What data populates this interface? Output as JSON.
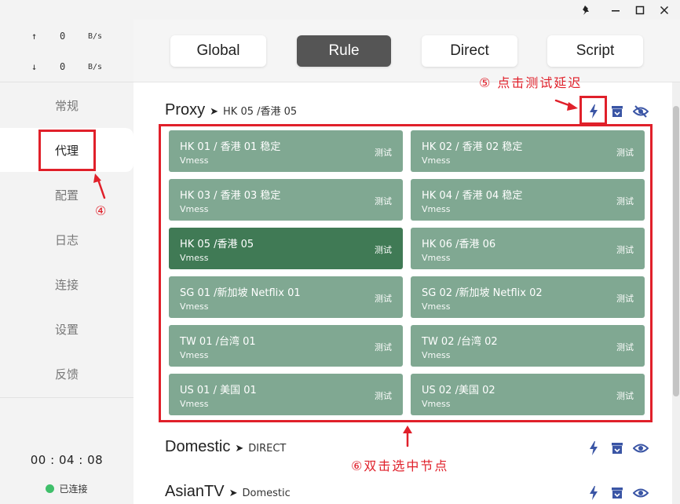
{
  "window": {
    "pin_icon": "pin-icon",
    "minimize_icon": "minimize-icon",
    "maximize_icon": "maximize-icon",
    "close_icon": "close-icon"
  },
  "traffic": {
    "up": {
      "arrow": "↑",
      "value": "0",
      "unit": "B/s"
    },
    "down": {
      "arrow": "↓",
      "value": "0",
      "unit": "B/s"
    }
  },
  "sidebar": {
    "items": [
      {
        "label": "常规",
        "active": false
      },
      {
        "label": "代理",
        "active": true
      },
      {
        "label": "配置",
        "active": false
      },
      {
        "label": "日志",
        "active": false
      },
      {
        "label": "连接",
        "active": false
      },
      {
        "label": "设置",
        "active": false
      },
      {
        "label": "反馈",
        "active": false
      }
    ],
    "timer": "00 : 04 : 08",
    "status": "已连接",
    "status_color": "#3fbf6a"
  },
  "modes": [
    {
      "label": "Global",
      "active": false
    },
    {
      "label": "Rule",
      "active": true
    },
    {
      "label": "Direct",
      "active": false
    },
    {
      "label": "Script",
      "active": false
    }
  ],
  "groups": [
    {
      "name": "Proxy",
      "arrow": "➤",
      "now": "HK 05 /香港 05",
      "icons": [
        "flash-icon",
        "box-icon",
        "eye-off-icon"
      ],
      "proxies": [
        {
          "name": "HK 01 / 香港 01 稳定",
          "type": "Vmess",
          "test": "测试",
          "selected": false
        },
        {
          "name": "HK 02 / 香港 02 稳定",
          "type": "Vmess",
          "test": "测试",
          "selected": false
        },
        {
          "name": "HK 03 / 香港 03 稳定",
          "type": "Vmess",
          "test": "测试",
          "selected": false
        },
        {
          "name": "HK 04 / 香港 04 稳定",
          "type": "Vmess",
          "test": "测试",
          "selected": false
        },
        {
          "name": "HK 05 /香港 05",
          "type": "Vmess",
          "test": "测试",
          "selected": true
        },
        {
          "name": "HK 06 /香港 06",
          "type": "Vmess",
          "test": "测试",
          "selected": false
        },
        {
          "name": "SG 01 /新加坡 Netflix 01",
          "type": "Vmess",
          "test": "测试",
          "selected": false
        },
        {
          "name": "SG 02 /新加坡 Netflix 02",
          "type": "Vmess",
          "test": "测试",
          "selected": false
        },
        {
          "name": "TW 01 /台湾 01",
          "type": "Vmess",
          "test": "测试",
          "selected": false
        },
        {
          "name": "TW 02 /台湾 02",
          "type": "Vmess",
          "test": "测试",
          "selected": false
        },
        {
          "name": "US 01 / 美国 01",
          "type": "Vmess",
          "test": "测试",
          "selected": false
        },
        {
          "name": "US 02 /美国 02",
          "type": "Vmess",
          "test": "测试",
          "selected": false
        }
      ]
    },
    {
      "name": "Domestic",
      "arrow": "➤",
      "now": "DIRECT",
      "icons": [
        "flash-icon",
        "box-icon",
        "eye-icon"
      ]
    },
    {
      "name": "AsianTV",
      "arrow": "➤",
      "now": "Domestic",
      "icons": [
        "flash-icon",
        "box-icon",
        "eye-icon"
      ]
    }
  ],
  "annotations": {
    "step4": "④",
    "step5": "⑤ 点击测试延迟",
    "step6": "⑥双击选中节点",
    "color": "#e0202a"
  },
  "colors": {
    "card": "#80a892",
    "card_selected": "#407a55",
    "icon_accent": "#3a55a5",
    "mode_active": "#555555"
  }
}
